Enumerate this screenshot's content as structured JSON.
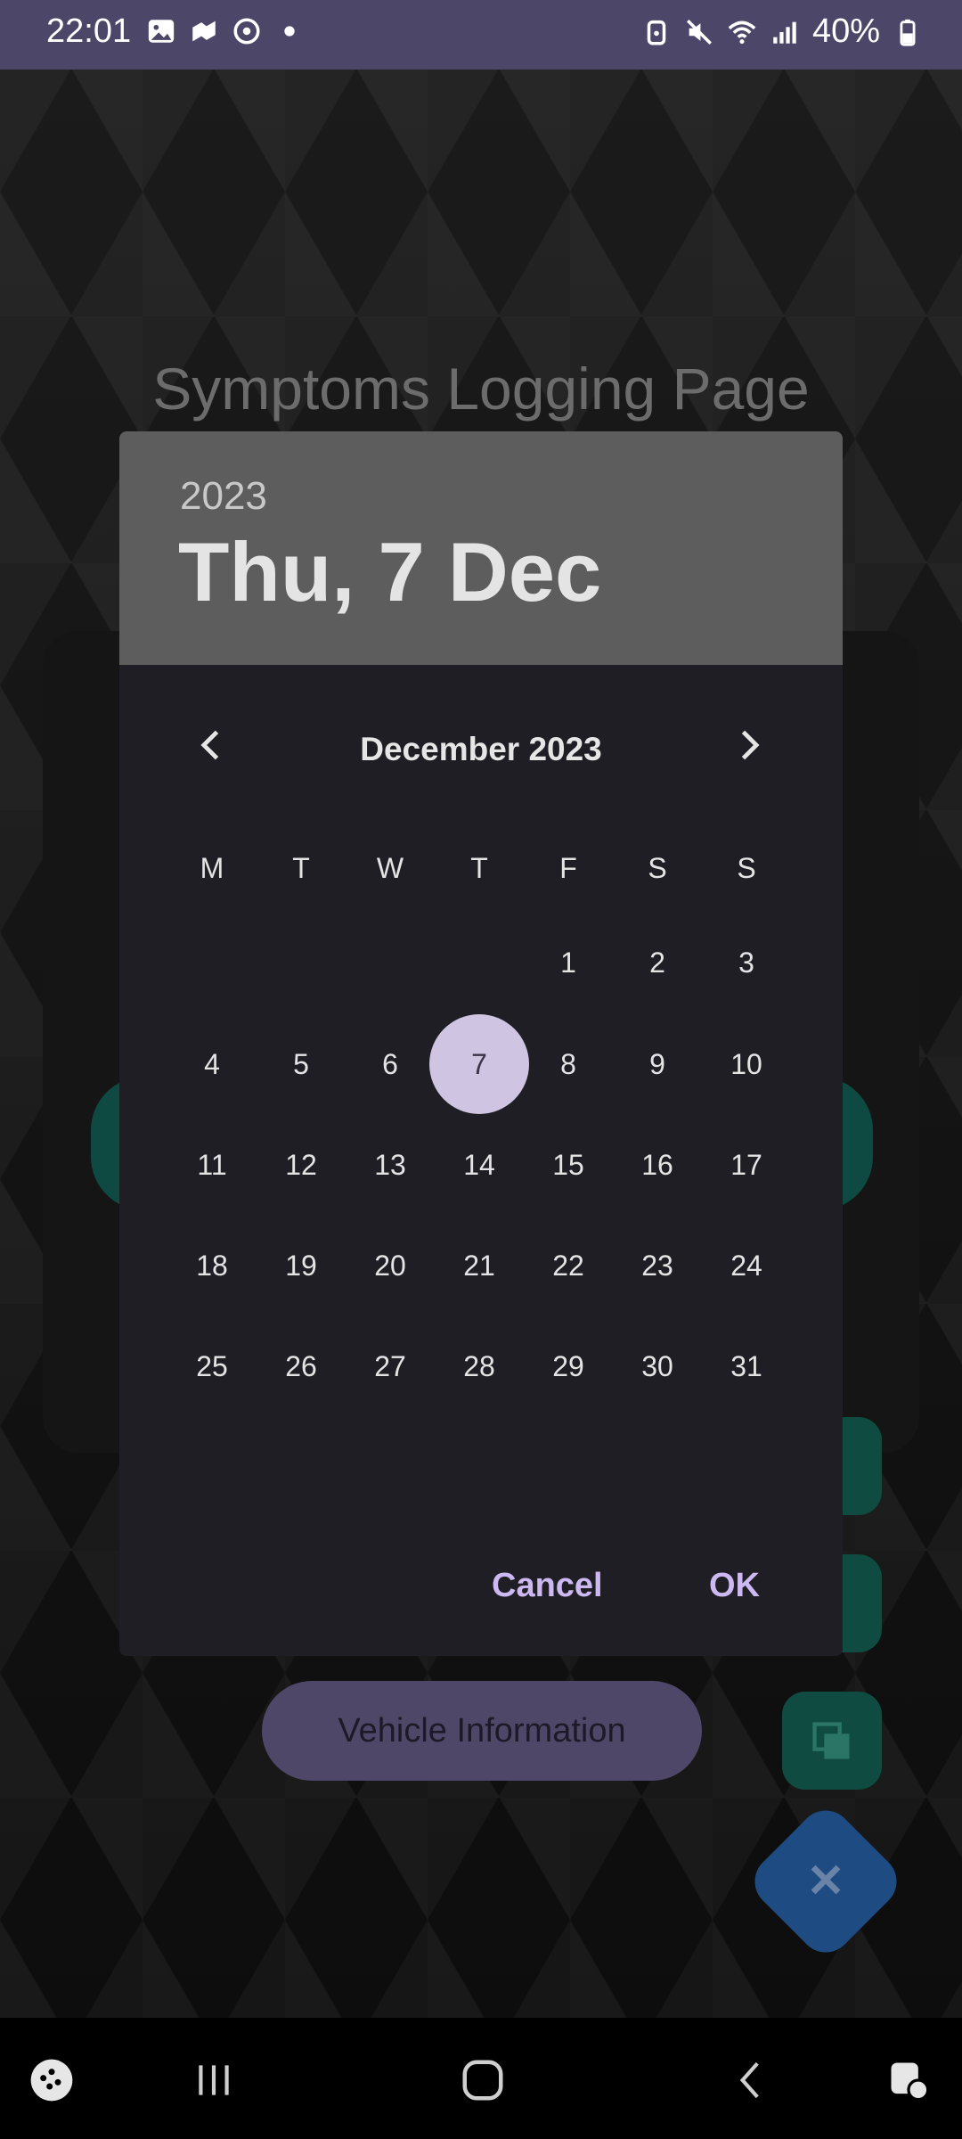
{
  "status_bar": {
    "time": "22:01",
    "battery": "40%",
    "left_icons": [
      "image-icon",
      "map-icon",
      "sync-icon",
      "dot-icon"
    ],
    "right_icons": [
      "alarm-icon",
      "mute-icon",
      "wifi-icon",
      "signal-icon",
      "battery-icon"
    ]
  },
  "background": {
    "page_title": "Symptoms Logging Page",
    "vehicle_button": "Vehicle Information",
    "fab_icon": "close-icon"
  },
  "date_picker": {
    "year": "2023",
    "selected_date": "Thu, 7 Dec",
    "month_title": "December 2023",
    "prev_icon": "chevron-left-icon",
    "next_icon": "chevron-right-icon",
    "weekdays": [
      "M",
      "T",
      "W",
      "T",
      "F",
      "S",
      "S"
    ],
    "days": [
      "1",
      "2",
      "3",
      "4",
      "5",
      "6",
      "7",
      "8",
      "9",
      "10",
      "11",
      "12",
      "13",
      "14",
      "15",
      "16",
      "17",
      "18",
      "19",
      "20",
      "21",
      "22",
      "23",
      "24",
      "25",
      "26",
      "27",
      "28",
      "29",
      "30",
      "31"
    ],
    "selected_day": "7",
    "cancel_label": "Cancel",
    "ok_label": "OK"
  },
  "colors": {
    "selected_day_bg": "#cfc5e2",
    "action_text": "#cdb9f2",
    "header_bg": "#5d5d5d",
    "dialog_bg": "#1f1e24"
  },
  "nav_bar": {
    "icons": [
      "game-launcher-icon",
      "recents-icon",
      "home-icon",
      "back-icon",
      "assistant-icon"
    ]
  }
}
